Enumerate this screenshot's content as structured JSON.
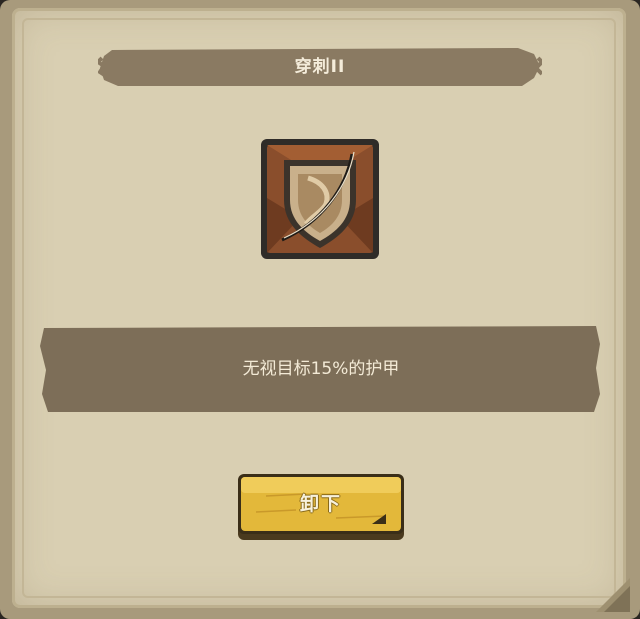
{
  "dialog": {
    "title": "穿刺II",
    "description": "无视目标15%的护甲",
    "unequip_label": "卸下"
  },
  "skill_icon": {
    "name": "pierce-shield-icon"
  },
  "colors": {
    "panel_bg": "#d9cfb2",
    "banner_bg": "#8a7a62",
    "desc_bg": "#7d6e58",
    "button_gold": "#e3b83a",
    "icon_frame": "#2f2c28"
  }
}
